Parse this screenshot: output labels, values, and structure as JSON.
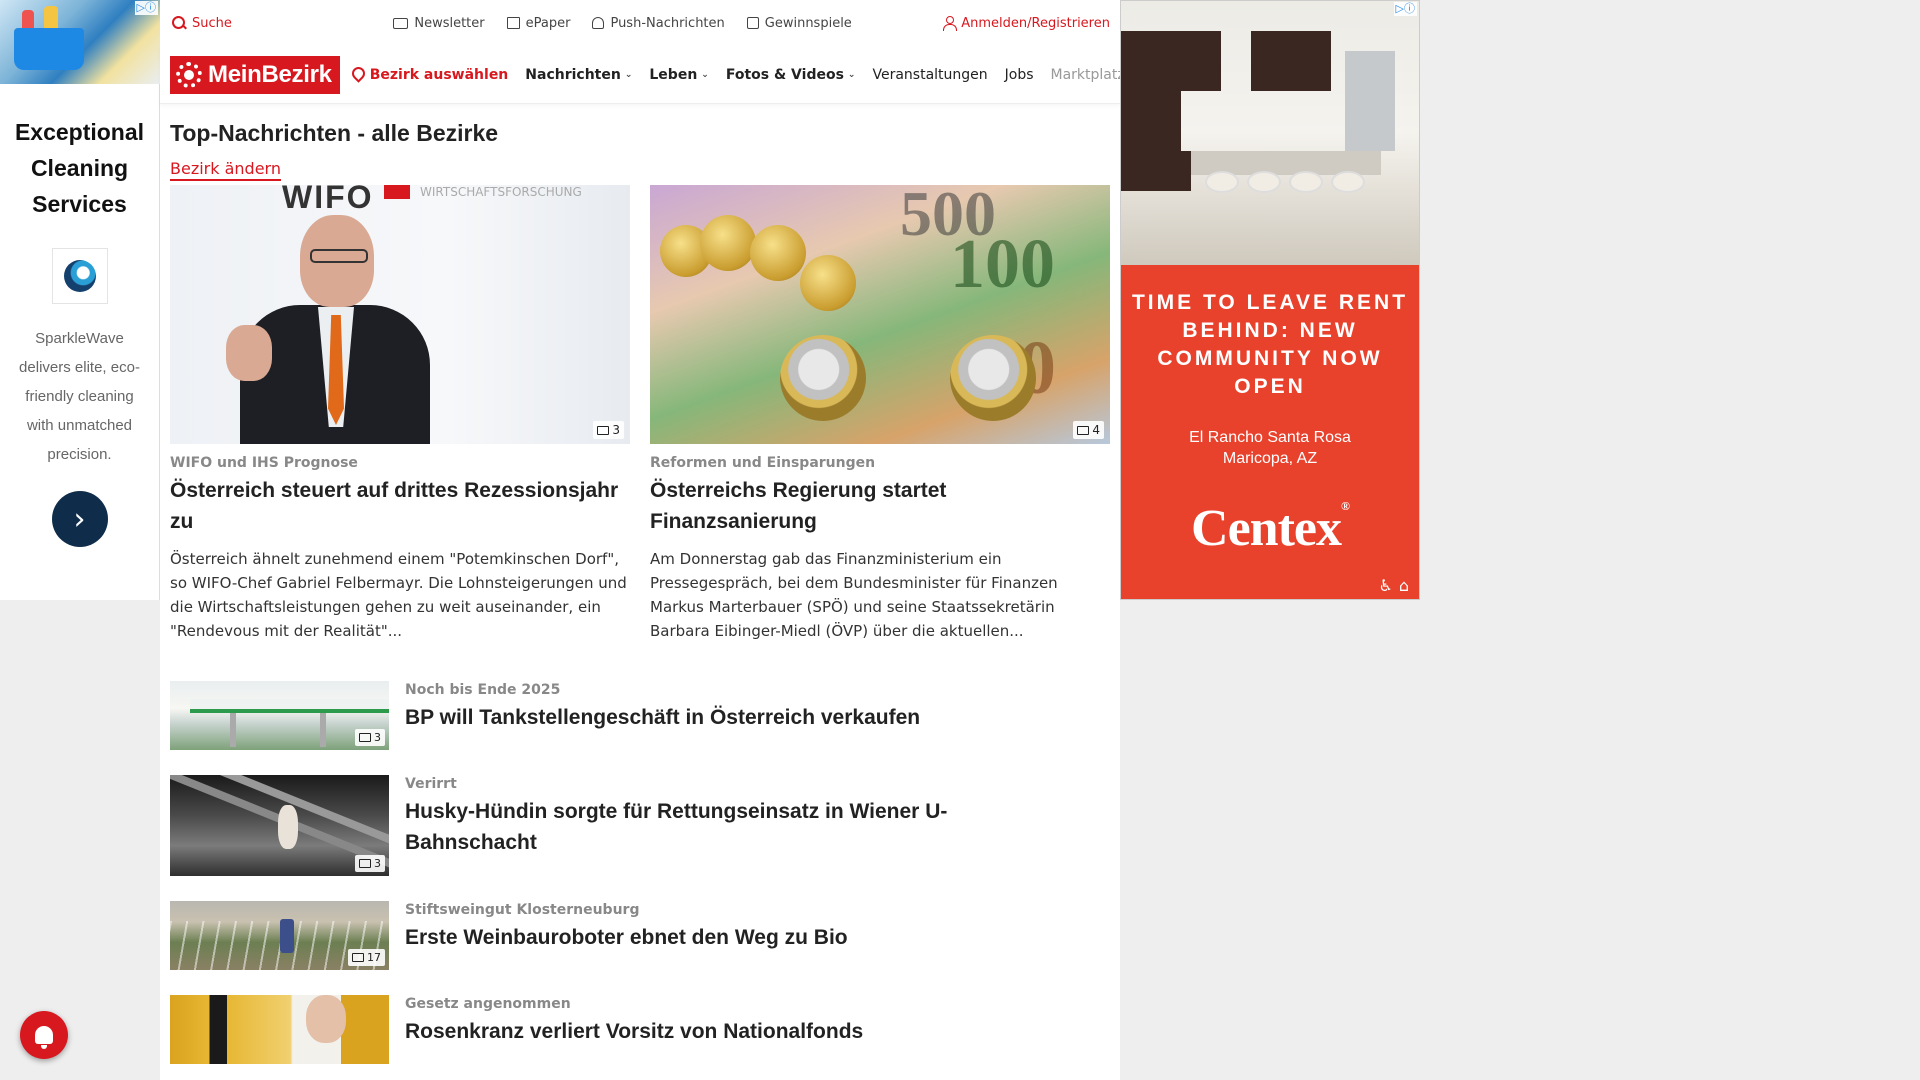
{
  "ad_left": {
    "choices": "▷ⓘ",
    "heading": "Exceptional Cleaning Services",
    "description": "SparkleWave delivers elite, eco-friendly cleaning with unmatched precision.",
    "arrow": "›"
  },
  "topbar": {
    "search": "Suche",
    "newsletter": "Newsletter",
    "epaper": "ePaper",
    "push": "Push-Nachrichten",
    "games": "Gewinnspiele",
    "login": "Anmelden/Registrieren"
  },
  "nav": {
    "brand": "MeinBezirk",
    "district": "Bezirk auswählen",
    "items": [
      "Nachrichten",
      "Leben",
      "Fotos & Videos",
      "Veranstaltungen",
      "Jobs",
      "Marktplatz"
    ]
  },
  "page": {
    "title": "Top-Nachrichten - alle Bezirke",
    "change_district": "Bezirk ändern"
  },
  "featured": [
    {
      "kicker": "WIFO und IHS Prognose",
      "headline": "Österreich steuert auf drittes Rezessionsjahr zu",
      "teaser": "Österreich ähnelt zunehmend einem \"Potemkinschen Dorf\", so WIFO-Chef Gabriel Felbermayr. Die Lohnsteigerungen und die Wirtschaftsleistungen gehen zu weit auseinander, ein \"Rendevous mit der Realität\"...",
      "photo_count": "3",
      "image_text": "WIFO",
      "image_subtext": "WIRTSCHAFTSFORSCHUNG"
    },
    {
      "kicker": "Reformen und Einsparungen",
      "headline": "Österreichs Regierung startet Finanzsanierung",
      "teaser": "Am Donnerstag gab das Finanzministerium ein Pressegespräch, bei dem Bundesminister für Finanzen Markus Marterbauer (SPÖ) und seine Staatssekretärin Barbara Eibinger-Miedl (ÖVP) über die aktuellen...",
      "photo_count": "4"
    }
  ],
  "articles": [
    {
      "kicker": "Noch bis Ende 2025",
      "headline": "BP will Tankstellengeschäft in Österreich verkaufen",
      "photo_count": "3"
    },
    {
      "kicker": "Verirrt",
      "headline": "Husky-Hündin sorgte für Rettungseinsatz in Wiener U-Bahnschacht",
      "photo_count": "3"
    },
    {
      "kicker": "Stiftsweingut Klosterneuburg",
      "headline": "Erste Weinbauroboter ebnet den Weg zu Bio",
      "photo_count": "17"
    },
    {
      "kicker": "Gesetz angenommen",
      "headline": "Rosenkranz verliert Vorsitz von Nationalfonds"
    }
  ],
  "ad_right": {
    "choices": "▷ⓘ",
    "tagline": "TIME TO LEAVE RENT BEHIND: NEW COMMUNITY NOW OPEN",
    "location_1": "El Rancho Santa Rosa",
    "location_2": "Maricopa, AZ",
    "brand": "Centex",
    "brand_mark": "®",
    "accent_color": "#e8412c"
  },
  "colors": {
    "brand_red": "#d7181f"
  }
}
